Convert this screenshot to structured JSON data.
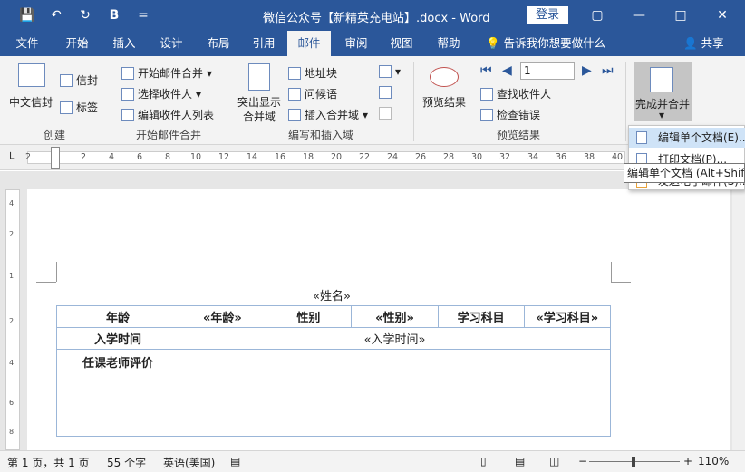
{
  "titlebar": {
    "doc_title": "微信公众号【新精英充电站】.docx  -  Word",
    "login_label": "登录",
    "qat": {
      "save": "💾",
      "undo": "↶",
      "redo": "↻",
      "format": "B",
      "more": "="
    },
    "window_controls": {
      "restore": "▢",
      "minimize": "—",
      "maximize": "□",
      "close": "✕"
    }
  },
  "tabs": [
    "文件",
    "开始",
    "插入",
    "设计",
    "布局",
    "引用",
    "邮件",
    "审阅",
    "视图",
    "帮助"
  ],
  "active_tab": "邮件",
  "tell_me": "告诉我你想要做什么",
  "share": "共享",
  "ribbon": {
    "groups": {
      "create": {
        "label": "创建",
        "chinese_envelope": "中文信封",
        "envelope": "信封",
        "labels": "标签"
      },
      "start_merge": {
        "label": "开始邮件合并",
        "start": "开始邮件合并",
        "select_recipients": "选择收件人",
        "edit_recipients": "编辑收件人列表"
      },
      "write_insert": {
        "label": "编写和插入域",
        "highlight_line1": "突出显示",
        "highlight_line2": "合并域",
        "address_block": "地址块",
        "greeting_line": "问候语",
        "insert_field": "插入合并域"
      },
      "preview": {
        "label": "预览结果",
        "preview_results": "预览结果",
        "record_value": "1",
        "find_recipient": "查找收件人",
        "check_errors": "检查错误"
      },
      "finish": {
        "finish_merge": "完成并合并"
      }
    }
  },
  "ruler_numbers": [
    "2",
    "2",
    "4",
    "6",
    "8",
    "10",
    "12",
    "14",
    "16",
    "18",
    "20",
    "22",
    "24",
    "26",
    "28",
    "30",
    "32",
    "34",
    "36",
    "38",
    "40"
  ],
  "vruler_numbers": [
    "4",
    "2",
    "1",
    "2",
    "4",
    "6",
    "8"
  ],
  "document": {
    "name_field": "«姓名»",
    "table": {
      "row1": [
        "年龄",
        "«年龄»",
        "性别",
        "«性别»",
        "学习科目",
        "«学习科目»"
      ],
      "row2_label": "入学时间",
      "row2_value": "«入学时间»",
      "row3_label": "任课老师评价",
      "row3_value": ""
    }
  },
  "dropdown": {
    "items": [
      "编辑单个文档(E)...",
      "打印文档(P)...",
      "发送电子邮件(S)..."
    ]
  },
  "tooltip": "编辑单个文档 (Alt+Shift+N)",
  "statusbar": {
    "page": "第 1 页，共 1 页",
    "words": "55 个字",
    "language": "英语(美国)",
    "zoom": "110%"
  }
}
